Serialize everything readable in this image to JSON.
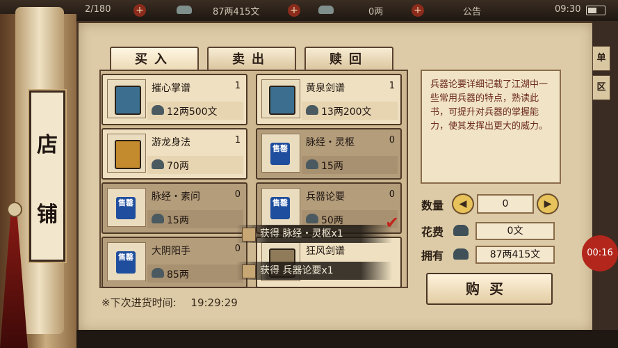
{
  "topbar": {
    "count": "2/180",
    "money": "87两415文",
    "ingots": "0两",
    "notice": "公告",
    "clock": "09:30"
  },
  "shop_title": [
    "店",
    "铺"
  ],
  "tabs": [
    {
      "label": "买入",
      "active": true
    },
    {
      "label": "卖出",
      "active": false
    },
    {
      "label": "赎回",
      "active": false
    }
  ],
  "items": [
    {
      "name": "摧心掌谱",
      "qty": "1",
      "price": "12两500文",
      "icon": "blue-book-icon",
      "dim": false
    },
    {
      "name": "黄泉剑谱",
      "qty": "1",
      "price": "13两200文",
      "icon": "blue-book-icon",
      "dim": false
    },
    {
      "name": "游龙身法",
      "qty": "1",
      "price": "70两",
      "icon": "gold-book-icon",
      "dim": false
    },
    {
      "name": "脉经・灵枢",
      "qty": "0",
      "price": "15两",
      "icon": "sold-out-stamp-icon",
      "stamp": "售罄",
      "dim": true
    },
    {
      "name": "脉经・素问",
      "qty": "0",
      "price": "15两",
      "icon": "sold-out-stamp-icon",
      "stamp": "售罄",
      "dim": true
    },
    {
      "name": "兵器论要",
      "qty": "0",
      "price": "50两",
      "icon": "sold-out-stamp-icon",
      "stamp": "售罄",
      "dim": true
    },
    {
      "name": "大阴阳手",
      "qty": "0",
      "price": "85两",
      "icon": "sold-out-stamp-icon",
      "stamp": "售罄",
      "dim": true
    },
    {
      "name": "狂风剑谱",
      "qty": "",
      "price": "",
      "icon": "sold-out-stamp-icon",
      "dim": false
    }
  ],
  "toasts": [
    "获得 脉经・灵枢x1",
    "获得 兵器论要x1"
  ],
  "restock": {
    "label": "※下次进货时间:",
    "time": "19:29:29"
  },
  "description": "兵器论要详细记载了江湖中一些常用兵器的特点，熟读此书，可提升对兵器的掌握能力，使其发挥出更大的威力。",
  "quantity": {
    "label": "数量",
    "value": "0"
  },
  "cost": {
    "label": "花费",
    "value": "0文"
  },
  "owned": {
    "label": "拥有",
    "value": "87两415文"
  },
  "buy_label": "购买",
  "side_tabs": [
    "单",
    "区"
  ],
  "timer": "00:16"
}
